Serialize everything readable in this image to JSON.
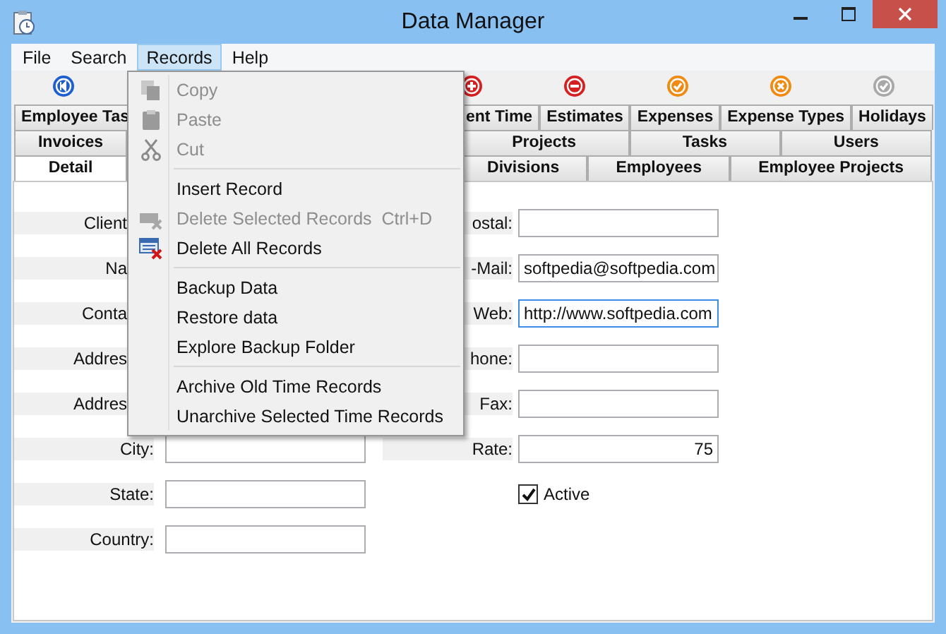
{
  "window": {
    "title": "Data Manager"
  },
  "menu_bar": [
    {
      "label": "File",
      "selected": false
    },
    {
      "label": "Search",
      "selected": false
    },
    {
      "label": "Records",
      "selected": true
    },
    {
      "label": "Help",
      "selected": false
    }
  ],
  "toolbar": [
    {
      "kind": "back"
    },
    {
      "kind": "add"
    },
    {
      "kind": "remove"
    },
    {
      "kind": "confirm"
    },
    {
      "kind": "cancel"
    },
    {
      "kind": "refresh"
    }
  ],
  "tab_rows": [
    {
      "left": [
        {
          "label": "Employee Tas",
          "selected": false
        }
      ],
      "right": [
        {
          "label": "ent Time",
          "selected": false
        },
        {
          "label": "Estimates",
          "selected": false
        },
        {
          "label": "Expenses",
          "selected": false
        },
        {
          "label": "Expense Types",
          "selected": false
        },
        {
          "label": "Holidays",
          "selected": false
        }
      ]
    },
    {
      "left": [
        {
          "label": "Invoices",
          "selected": false
        }
      ],
      "right": [
        {
          "label": "Projects",
          "selected": false
        },
        {
          "label": "Tasks",
          "selected": false
        },
        {
          "label": "Users",
          "selected": false
        }
      ]
    },
    {
      "left": [
        {
          "label": "Detail",
          "selected": true
        }
      ],
      "right": [
        {
          "label": "Divisions",
          "selected": false
        },
        {
          "label": "Employees",
          "selected": false
        },
        {
          "label": "Employee Projects",
          "selected": false
        }
      ]
    }
  ],
  "left_fields": [
    {
      "label": "Client",
      "kind": "hidden"
    },
    {
      "label": "Na",
      "kind": "hidden"
    },
    {
      "label": "Conta",
      "kind": "hidden"
    },
    {
      "label": "Addres",
      "kind": "hidden"
    },
    {
      "label": "Addres",
      "kind": "hidden"
    },
    {
      "label": "City:",
      "kind": "text"
    },
    {
      "label": "State:",
      "kind": "text"
    },
    {
      "label": "Country:",
      "kind": "text"
    }
  ],
  "right_fields": [
    {
      "label": "ostal:",
      "kind": "text",
      "focused": false
    },
    {
      "label": "-Mail:",
      "kind": "text",
      "value": "softpedia@softpedia.com",
      "focused": false
    },
    {
      "label": "Web:",
      "kind": "text",
      "value": "http://www.softpedia.com",
      "focused": true
    },
    {
      "label": "hone:",
      "kind": "text",
      "focused": false
    },
    {
      "label": "Fax:",
      "kind": "text",
      "focused": false
    },
    {
      "label": "Rate:",
      "kind": "number",
      "value": "75",
      "focused": false
    }
  ],
  "active": {
    "label": "Active",
    "checked": true
  },
  "records_menu": [
    {
      "kind": "copy",
      "label": "Copy",
      "disabled": true
    },
    {
      "kind": "paste",
      "label": "Paste",
      "disabled": true
    },
    {
      "kind": "cut",
      "label": "Cut",
      "disabled": true
    },
    {
      "kind": "separator"
    },
    {
      "kind": "item",
      "label": "Insert Record",
      "disabled": false
    },
    {
      "kind": "delete",
      "label": "Delete Selected Records",
      "shortcut": "Ctrl+D",
      "disabled": true
    },
    {
      "kind": "delete-all",
      "label": "Delete All Records",
      "disabled": false
    },
    {
      "kind": "separator"
    },
    {
      "kind": "item",
      "label": "Backup Data",
      "disabled": false
    },
    {
      "kind": "item",
      "label": "Restore data",
      "disabled": false
    },
    {
      "kind": "item",
      "label": "Explore Backup Folder",
      "disabled": false
    },
    {
      "kind": "separator"
    },
    {
      "kind": "item",
      "label": "Archive Old Time Records",
      "disabled": false
    },
    {
      "kind": "item",
      "label": "Unarchive Selected Time Records",
      "disabled": false
    }
  ]
}
